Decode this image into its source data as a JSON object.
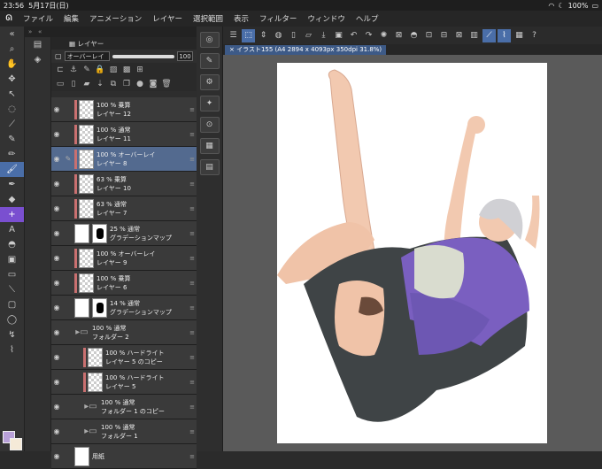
{
  "status": {
    "time": "23:56",
    "date": "5月17日(日)",
    "battery": "100%"
  },
  "menu": [
    "ファイル",
    "編集",
    "アニメーション",
    "レイヤー",
    "選択範囲",
    "表示",
    "フィルター",
    "ウィンドウ",
    "ヘルプ"
  ],
  "panel": {
    "tab": "レイヤー",
    "blend_mode": "オーバーレイ",
    "opacity": "100"
  },
  "doc_tab": "イラスト155 (A4 2894 x 4093px 350dpi 31.8%)",
  "layers": [
    {
      "mode": "100 % 乗算",
      "name": "レイヤー 12",
      "type": "raster"
    },
    {
      "mode": "100 % 通常",
      "name": "レイヤー 11",
      "type": "raster"
    },
    {
      "mode": "100 % オーバーレイ",
      "name": "レイヤー 8",
      "type": "raster",
      "selected": true
    },
    {
      "mode": "63 % 乗算",
      "name": "レイヤー 10",
      "type": "raster"
    },
    {
      "mode": "63 % 通常",
      "name": "レイヤー 7",
      "type": "raster"
    },
    {
      "mode": "25 % 通常",
      "name": "グラデーションマップ",
      "type": "mask"
    },
    {
      "mode": "100 % オーバーレイ",
      "name": "レイヤー 9",
      "type": "raster"
    },
    {
      "mode": "100 % 乗算",
      "name": "レイヤー 6",
      "type": "raster"
    },
    {
      "mode": "14 % 通常",
      "name": "グラデーションマップ",
      "type": "mask"
    },
    {
      "mode": "100 % 通常",
      "name": "フォルダー 2",
      "type": "folder"
    },
    {
      "mode": "100 % ハードライト",
      "name": "レイヤー 5 のコピー",
      "type": "raster",
      "indent": true
    },
    {
      "mode": "100 % ハードライト",
      "name": "レイヤー 5",
      "type": "raster",
      "indent": true
    },
    {
      "mode": "100 % 通常",
      "name": "フォルダー 1 のコピー",
      "type": "folder",
      "indent": true
    },
    {
      "mode": "100 % 通常",
      "name": "フォルダー 1",
      "type": "folder",
      "indent": true
    },
    {
      "mode": "",
      "name": "用紙",
      "type": "paper"
    }
  ],
  "colors": {
    "fg": "#b8a0d8",
    "bg": "#f5ead8",
    "accent": "#4a6ea8"
  }
}
